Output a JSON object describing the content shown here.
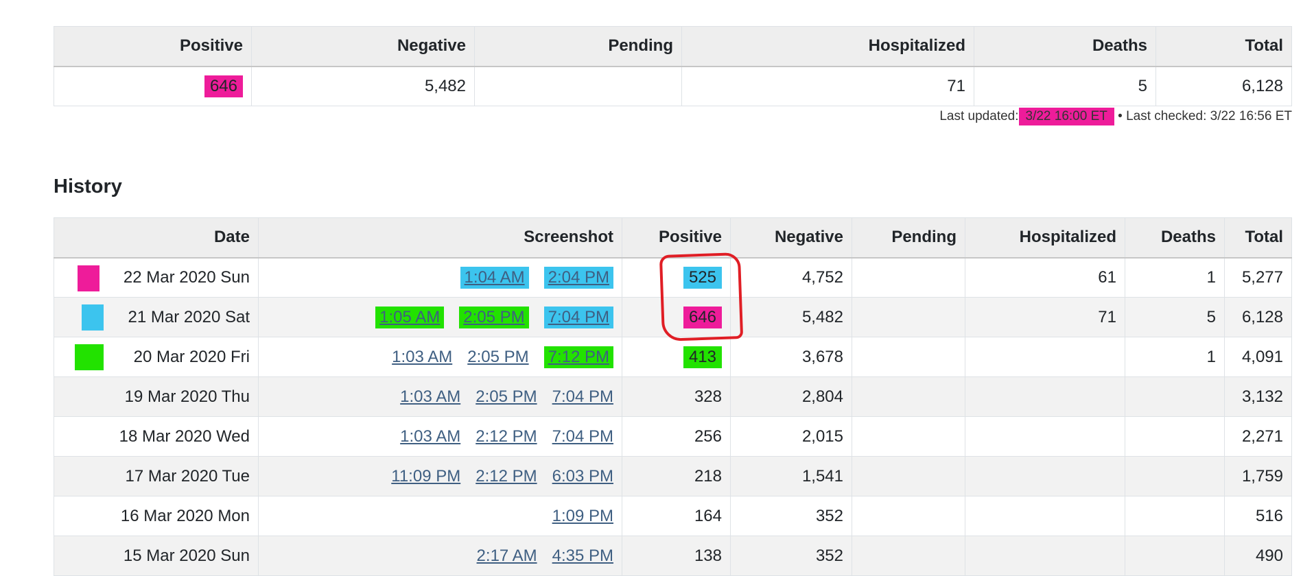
{
  "current": {
    "headers": [
      "Positive",
      "Negative",
      "Pending",
      "Hospitalized",
      "Deaths",
      "Total"
    ],
    "row": [
      "646",
      "5,482",
      "",
      "71",
      "5",
      "6,128"
    ]
  },
  "updated": {
    "last_updated_label": "Last updated:",
    "last_updated_value": "3/22 16:00 ET",
    "separator": "•",
    "last_checked": "Last checked: 3/22 16:56 ET"
  },
  "history": {
    "title": "History",
    "headers": [
      "Date",
      "Screenshot",
      "Positive",
      "Negative",
      "Pending",
      "Hospitalized",
      "Deaths",
      "Total"
    ],
    "rows": [
      {
        "date": "22 Mar 2020 Sun",
        "shots": [
          "1:04 AM",
          "2:04 PM"
        ],
        "positive": "525",
        "negative": "4,752",
        "pending": "",
        "hospitalized": "61",
        "deaths": "1",
        "total": "5,277"
      },
      {
        "date": "21 Mar 2020 Sat",
        "shots": [
          "1:05 AM",
          "2:05 PM",
          "7:04 PM"
        ],
        "positive": "646",
        "negative": "5,482",
        "pending": "",
        "hospitalized": "71",
        "deaths": "5",
        "total": "6,128"
      },
      {
        "date": "20 Mar 2020 Fri",
        "shots": [
          "1:03 AM",
          "2:05 PM",
          "7:12 PM"
        ],
        "positive": "413",
        "negative": "3,678",
        "pending": "",
        "hospitalized": "",
        "deaths": "1",
        "total": "4,091"
      },
      {
        "date": "19 Mar 2020 Thu",
        "shots": [
          "1:03 AM",
          "2:05 PM",
          "7:04 PM"
        ],
        "positive": "328",
        "negative": "2,804",
        "pending": "",
        "hospitalized": "",
        "deaths": "",
        "total": "3,132"
      },
      {
        "date": "18 Mar 2020 Wed",
        "shots": [
          "1:03 AM",
          "2:12 PM",
          "7:04 PM"
        ],
        "positive": "256",
        "negative": "2,015",
        "pending": "",
        "hospitalized": "",
        "deaths": "",
        "total": "2,271"
      },
      {
        "date": "17 Mar 2020 Tue",
        "shots": [
          "11:09 PM",
          "2:12 PM",
          "6:03 PM"
        ],
        "positive": "218",
        "negative": "1,541",
        "pending": "",
        "hospitalized": "",
        "deaths": "",
        "total": "1,759"
      },
      {
        "date": "16 Mar 2020 Mon",
        "shots": [
          "1:09 PM"
        ],
        "positive": "164",
        "negative": "352",
        "pending": "",
        "hospitalized": "",
        "deaths": "",
        "total": "516"
      },
      {
        "date": "15 Mar 2020 Sun",
        "shots": [
          "2:17 AM",
          "4:35 PM"
        ],
        "positive": "138",
        "negative": "352",
        "pending": "",
        "hospitalized": "",
        "deaths": "",
        "total": "490"
      }
    ]
  },
  "colors": {
    "highlight_pink": "#ee1c9a",
    "highlight_blue": "#3cc4ee",
    "highlight_green": "#22e200",
    "annotation_red": "#e01e25"
  }
}
